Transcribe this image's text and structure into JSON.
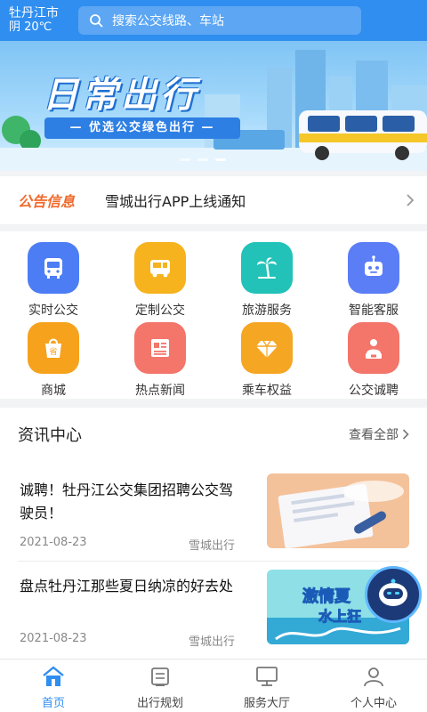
{
  "header": {
    "city": "牡丹江市",
    "weather": "阴 20℃",
    "search_placeholder": "搜索公交线路、车站"
  },
  "banner": {
    "title": "日常出行",
    "subtitle": "— 优选公交绿色出行 —",
    "slide_count": 3,
    "active_slide": 3
  },
  "notice": {
    "tag": "公告信息",
    "text": "雪城出行APP上线通知"
  },
  "services": [
    {
      "label": "实时公交",
      "icon": "bus-icon",
      "color": "#4c7df5"
    },
    {
      "label": "定制公交",
      "icon": "custom-bus-icon",
      "color": "#f6b31e"
    },
    {
      "label": "旅游服务",
      "icon": "palm-tree-icon",
      "color": "#22c2b8"
    },
    {
      "label": "智能客服",
      "icon": "robot-icon",
      "color": "#5b7ef6"
    },
    {
      "label": "商城",
      "icon": "shopping-bag-icon",
      "color": "#f6a21c"
    },
    {
      "label": "热点新闻",
      "icon": "newspaper-icon",
      "color": "#f4756a"
    },
    {
      "label": "乘车权益",
      "icon": "diamond-icon",
      "color": "#f5a623"
    },
    {
      "label": "公交诚聘",
      "icon": "recruit-icon",
      "color": "#f4756a"
    }
  ],
  "news": {
    "title": "资讯中心",
    "more": "查看全部",
    "items": [
      {
        "text": "诚聘！牡丹江公交集团招聘公交驾驶员！",
        "date": "2021-08-23",
        "source": "雪城出行"
      },
      {
        "text": "盘点牡丹江那些夏日纳凉的好去处",
        "date": "2021-08-23",
        "source": "雪城出行",
        "thumb_text_1": "激情夏",
        "thumb_text_2": "水上狂"
      }
    ]
  },
  "tabs": [
    {
      "label": "首页",
      "icon": "home-icon",
      "active": true
    },
    {
      "label": "出行规划",
      "icon": "route-plan-icon",
      "active": false
    },
    {
      "label": "服务大厅",
      "icon": "monitor-icon",
      "active": false
    },
    {
      "label": "个人中心",
      "icon": "user-icon",
      "active": false
    }
  ],
  "colors": {
    "primary": "#2f8ef0",
    "notice_tag": "#f06a2c"
  }
}
